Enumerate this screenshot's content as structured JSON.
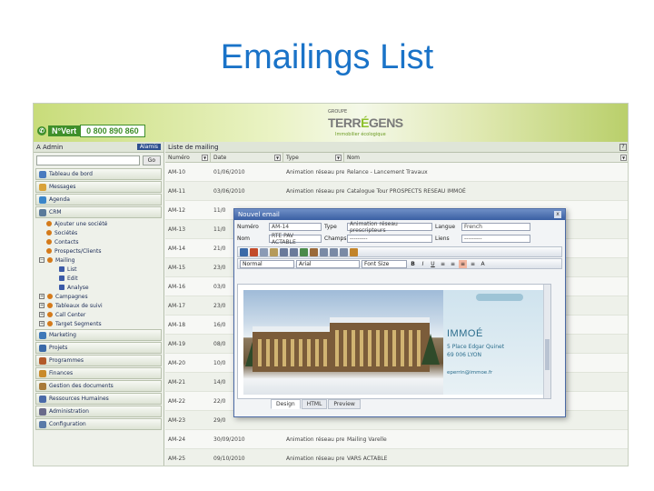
{
  "slide": {
    "title": "Emailings List"
  },
  "header": {
    "vert_label": "N°Vert",
    "vert_number": "0 800 890 860",
    "logo_groupe": "GROUPE",
    "logo_name_a": "TERR",
    "logo_name_e": "É",
    "logo_name_b": "GENS",
    "logo_sub": "Immobilier écologique"
  },
  "sidebar": {
    "admin_label": "A  Admin",
    "admin_tag": "Alamis",
    "go_label": "Go",
    "top_items": [
      {
        "label": "Tableau de bord",
        "color": "#4a7bbf"
      },
      {
        "label": "Messages",
        "color": "#d9a23a"
      },
      {
        "label": "Agenda",
        "color": "#3b86c9"
      },
      {
        "label": "CRM",
        "color": "#5a7a9a"
      }
    ],
    "crm_tree": [
      "Ajouter une société",
      "Sociétés",
      "Contacts",
      "Prospects/Clients",
      "Mailing",
      "List",
      "Edit",
      "Analyse",
      "Campagnes",
      "Tableaux de suivi",
      "Call Center",
      "Target Segments"
    ],
    "bottom_items": [
      {
        "label": "Marketing",
        "color": "#3e78b8"
      },
      {
        "label": "Projets",
        "color": "#3b6aa8"
      },
      {
        "label": "Programmes",
        "color": "#b25a2a"
      },
      {
        "label": "Finances",
        "color": "#c98a2a"
      },
      {
        "label": "Gestion des documents",
        "color": "#a87a3a"
      },
      {
        "label": "Ressources Humaines",
        "color": "#4a6aa8"
      },
      {
        "label": "Administration",
        "color": "#6a6a8a"
      },
      {
        "label": "Configuration",
        "color": "#5a7aa8"
      }
    ]
  },
  "main": {
    "title": "Liste de mailing",
    "help": "?",
    "columns": [
      "Numéro",
      "Date",
      "Type",
      "Nom"
    ],
    "rows": [
      [
        "AM-10",
        "01/06/2010",
        "Animation réseau prescripteurs",
        "Relance - Lancement Travaux"
      ],
      [
        "AM-11",
        "03/06/2010",
        "Animation réseau prescripteurs",
        "Catalogue Tour PROSPECTS RESEAU IMMOÉ"
      ],
      [
        "AM-12",
        "11/0",
        "",
        ""
      ],
      [
        "AM-13",
        "11/0",
        "",
        ""
      ],
      [
        "AM-14",
        "21/0",
        "",
        ""
      ],
      [
        "AM-15",
        "23/0",
        "",
        ""
      ],
      [
        "AM-16",
        "03/0",
        "",
        ""
      ],
      [
        "AM-17",
        "23/0",
        "",
        ""
      ],
      [
        "AM-18",
        "16/0",
        "",
        ""
      ],
      [
        "AM-19",
        "08/0",
        "",
        ""
      ],
      [
        "AM-20",
        "10/0",
        "",
        ""
      ],
      [
        "AM-21",
        "14/0",
        "",
        ""
      ],
      [
        "AM-22",
        "22/0",
        "",
        ""
      ],
      [
        "AM-23",
        "29/0",
        "",
        ""
      ],
      [
        "AM-24",
        "30/09/2010",
        "Animation réseau prescripteurs",
        "Mailing Varelle"
      ],
      [
        "AM-25",
        "09/10/2010",
        "Animation réseau prescripteurs",
        "VARS ACTABLE"
      ]
    ]
  },
  "dialog": {
    "title": "Nouvel email",
    "close": "x",
    "fields": {
      "numero_label": "Numéro",
      "numero_value": "AM-14",
      "type_label": "Type",
      "type_value": "Animation réseau prescripteurs",
      "langue_label": "Langue",
      "langue_value": "French",
      "nom_label": "Nom",
      "nom_value": "RTE PAV ACTABLE",
      "champs_label": "Champs",
      "champs_value": "---------",
      "liens_label": "Liens",
      "liens_value": "---------"
    },
    "format_style": "Normal",
    "format_font": "Arial",
    "format_size": "Font Size",
    "bold": "B",
    "italic": "I",
    "underline": "U",
    "preview": {
      "brand": "IMMOÉ",
      "address_1": "5 Place Edgar Quinet",
      "address_2": "69 006 LYON",
      "email": "eperrin@immoe.fr"
    },
    "tabs": [
      "Design",
      "HTML",
      "Preview"
    ]
  }
}
